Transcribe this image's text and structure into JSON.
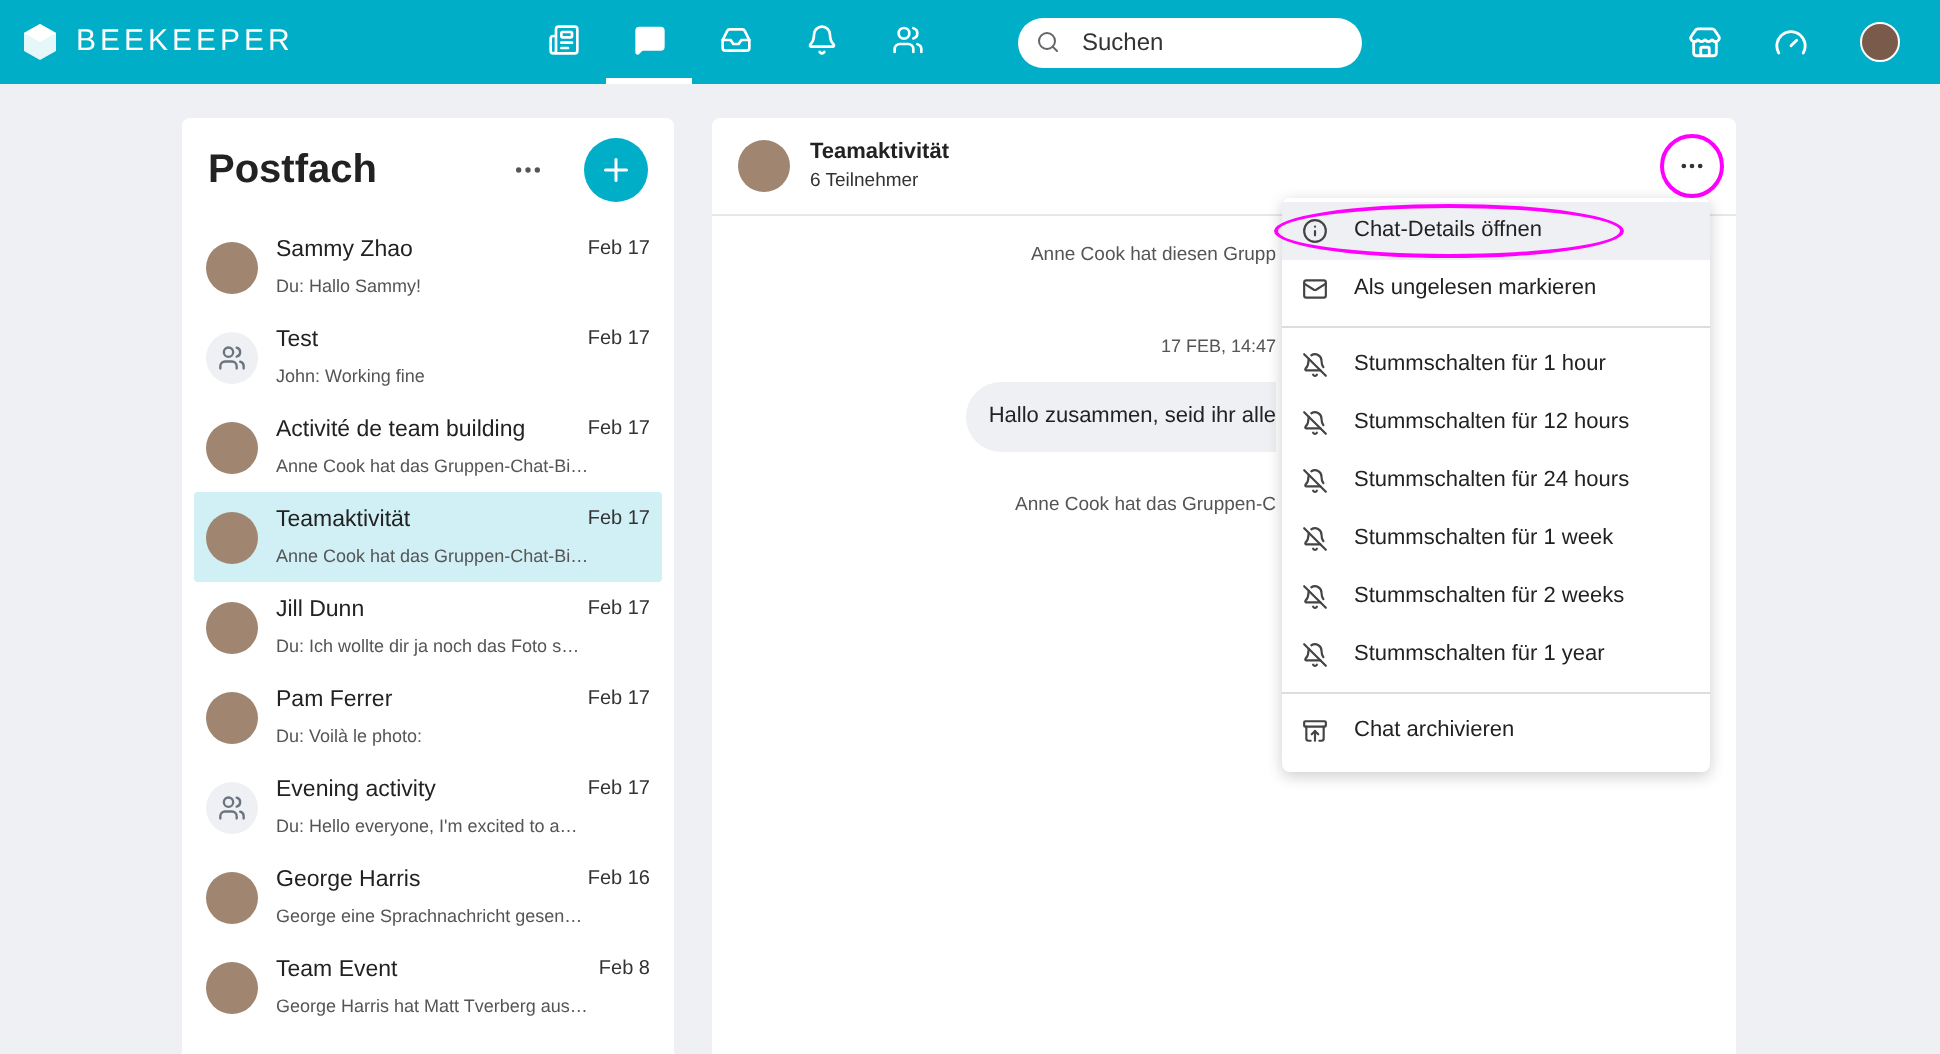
{
  "brand": "BEEKEEPER",
  "nav": [
    {
      "kind": "news",
      "selected": false
    },
    {
      "kind": "chat",
      "selected": true
    },
    {
      "kind": "inbox",
      "selected": false
    },
    {
      "kind": "bell",
      "selected": false
    },
    {
      "kind": "people",
      "selected": false
    }
  ],
  "search": {
    "placeholder": "Suchen"
  },
  "inbox": {
    "title": "Postfach",
    "chats": [
      {
        "name": "Sammy Zhao",
        "date": "Feb 17",
        "preview": "Du: Hallo Sammy!",
        "kind": "photo",
        "selected": false
      },
      {
        "name": "Test",
        "date": "Feb 17",
        "preview": "John: Working fine",
        "kind": "group",
        "selected": false
      },
      {
        "name": "Activité de team building",
        "date": "Feb 17",
        "preview": "Anne Cook hat das Gruppen-Chat-Bi…",
        "kind": "photo",
        "selected": false
      },
      {
        "name": "Teamaktivität",
        "date": "Feb 17",
        "preview": "Anne Cook hat das Gruppen-Chat-Bi…",
        "kind": "photo",
        "selected": true
      },
      {
        "name": "Jill Dunn",
        "date": "Feb 17",
        "preview": "Du: Ich wollte dir ja noch das Foto s…",
        "kind": "photo",
        "selected": false
      },
      {
        "name": "Pam Ferrer",
        "date": "Feb 17",
        "preview": "Du: Voilà le photo:",
        "kind": "photo",
        "selected": false
      },
      {
        "name": "Evening activity",
        "date": "Feb 17",
        "preview": "Du: Hello everyone, I'm excited to a…",
        "kind": "group",
        "selected": false
      },
      {
        "name": "George Harris",
        "date": "Feb 16",
        "preview": "George eine Sprachnachricht gesen…",
        "kind": "photo",
        "selected": false
      },
      {
        "name": "Team Event",
        "date": "Feb 8",
        "preview": "George Harris hat Matt Tverberg aus…",
        "kind": "photo",
        "selected": false
      }
    ]
  },
  "chat": {
    "title": "Teamaktivität",
    "subtitle": "6 Teilnehmer",
    "more_circled": true,
    "messages": [
      {
        "kind": "system",
        "text": "Anne Cook hat diesen Grupp"
      },
      {
        "kind": "time",
        "text": "17 FEB, 14:47"
      },
      {
        "kind": "bubble",
        "text": "Hallo zusammen, seid ihr alle"
      },
      {
        "kind": "system",
        "text": "Anne Cook hat das Gruppen-C"
      }
    ]
  },
  "menu": {
    "groups": [
      [
        {
          "label": "Chat-Details öffnen",
          "kind": "info",
          "selected": true,
          "circled": true
        },
        {
          "label": "Als ungelesen markieren",
          "kind": "mail",
          "selected": false,
          "circled": false
        }
      ],
      [
        {
          "label": "Stummschalten für 1 hour",
          "kind": "mute",
          "selected": false,
          "circled": false
        },
        {
          "label": "Stummschalten für 12 hours",
          "kind": "mute",
          "selected": false,
          "circled": false
        },
        {
          "label": "Stummschalten für 24 hours",
          "kind": "mute",
          "selected": false,
          "circled": false
        },
        {
          "label": "Stummschalten für 1 week",
          "kind": "mute",
          "selected": false,
          "circled": false
        },
        {
          "label": "Stummschalten für 2 weeks",
          "kind": "mute",
          "selected": false,
          "circled": false
        },
        {
          "label": "Stummschalten für 1 year",
          "kind": "mute",
          "selected": false,
          "circled": false
        }
      ],
      [
        {
          "label": "Chat archivieren",
          "kind": "archive",
          "selected": false,
          "circled": false
        }
      ]
    ]
  }
}
